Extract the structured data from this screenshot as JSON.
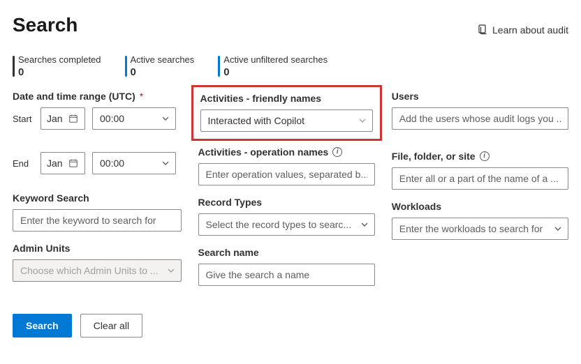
{
  "header": {
    "title": "Search",
    "learn_link": "Learn about audit"
  },
  "counters": {
    "completed": {
      "label": "Searches completed",
      "value": "0"
    },
    "active": {
      "label": "Active searches",
      "value": "0"
    },
    "unfiltered": {
      "label": "Active unfiltered searches",
      "value": "0"
    }
  },
  "dateRange": {
    "label": "Date and time range (UTC)",
    "required_mark": "*",
    "start_label": "Start",
    "end_label": "End",
    "start_month": "Jan",
    "start_time": "00:00",
    "end_month": "Jan",
    "end_time": "00:00"
  },
  "keyword": {
    "label": "Keyword Search",
    "placeholder": "Enter the keyword to search for"
  },
  "adminUnits": {
    "label": "Admin Units",
    "placeholder": "Choose which Admin Units to ..."
  },
  "activitiesFriendly": {
    "label": "Activities - friendly names",
    "value": "Interacted with Copilot"
  },
  "activitiesOps": {
    "label": "Activities - operation names",
    "placeholder": "Enter operation values, separated b..."
  },
  "recordTypes": {
    "label": "Record Types",
    "placeholder": "Select the record types to searc..."
  },
  "searchName": {
    "label": "Search name",
    "placeholder": "Give the search a name"
  },
  "users": {
    "label": "Users",
    "placeholder": "Add the users whose audit logs you ..."
  },
  "fileFolder": {
    "label": "File, folder, or site",
    "placeholder": "Enter all or a part of the name of a ..."
  },
  "workloads": {
    "label": "Workloads",
    "placeholder": "Enter the workloads to search for"
  },
  "buttons": {
    "search": "Search",
    "clear": "Clear all"
  }
}
